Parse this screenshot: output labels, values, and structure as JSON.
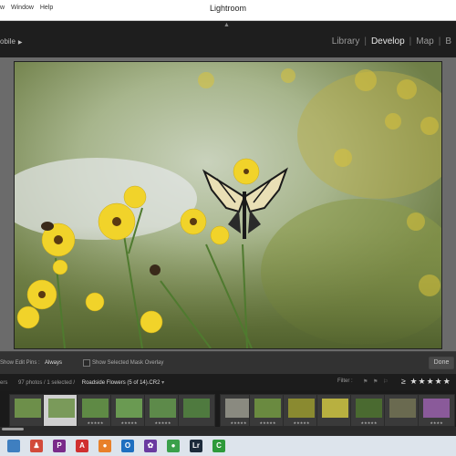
{
  "app": {
    "title": "Lightroom",
    "menu": [
      "w",
      "Window",
      "Help"
    ]
  },
  "header": {
    "left_label": "obile",
    "modules": [
      "Library",
      "Develop",
      "Map",
      "B"
    ],
    "active_module": "Develop"
  },
  "toolbar": {
    "show_edit_pins_label": "Show Edit Pins :",
    "show_edit_pins_value": "Always",
    "mask_overlay_label": "Show Selected Mask Overlay",
    "done_label": "Done"
  },
  "filmstrip_bar": {
    "source_label": "ers",
    "count_text": "97 photos / 1 selected /",
    "filename": "Roadside Flowers (5 of 14).CR2",
    "filter_label": "Filter :",
    "filter_stars": "≥ ★★★★★"
  },
  "filmstrip": {
    "thumbnails": [
      {
        "rating": "",
        "selected": false,
        "color": "#6d8f4a"
      },
      {
        "rating": "",
        "selected": true,
        "color": "#7a9a5a"
      },
      {
        "rating": "★★★★★",
        "selected": false,
        "color": "#5f8a45"
      },
      {
        "rating": "★★★★★",
        "selected": false,
        "color": "#6a9a52"
      },
      {
        "rating": "★★★★★",
        "selected": false,
        "color": "#5d8a4a"
      },
      {
        "rating": "",
        "selected": false,
        "color": "#4f7a3f"
      },
      {
        "rating": "★★★★★",
        "selected": false,
        "color": "#8a8a80"
      },
      {
        "rating": "★★★★★",
        "selected": false,
        "color": "#6a8a40"
      },
      {
        "rating": "★★★★★",
        "selected": false,
        "color": "#8a8a30"
      },
      {
        "rating": "",
        "selected": false,
        "color": "#b8b040"
      },
      {
        "rating": "★★★★★",
        "selected": false,
        "color": "#4a6a30"
      },
      {
        "rating": "",
        "selected": false,
        "color": "#6a6a50"
      },
      {
        "rating": "★★★★",
        "selected": false,
        "color": "#8a5a9a"
      }
    ]
  },
  "taskbar": {
    "icons": [
      {
        "name": "app-icon",
        "color": "#3f7fc0",
        "glyph": ""
      },
      {
        "name": "people-icon",
        "color": "#d24a3a",
        "glyph": "♟"
      },
      {
        "name": "publisher-icon",
        "color": "#7a2a8a",
        "glyph": "P"
      },
      {
        "name": "pdf-icon",
        "color": "#d03030",
        "glyph": "A"
      },
      {
        "name": "firefox-icon",
        "color": "#e8802a",
        "glyph": "●"
      },
      {
        "name": "outlook-icon",
        "color": "#1f6fc0",
        "glyph": "O"
      },
      {
        "name": "app-purple-icon",
        "color": "#6a3aa0",
        "glyph": "✿"
      },
      {
        "name": "chrome-icon",
        "color": "#3aa04a",
        "glyph": "●"
      },
      {
        "name": "lightroom-icon",
        "color": "#1c2a3a",
        "glyph": "Lr"
      },
      {
        "name": "camtasia-icon",
        "color": "#2e9a3a",
        "glyph": "C"
      }
    ]
  }
}
